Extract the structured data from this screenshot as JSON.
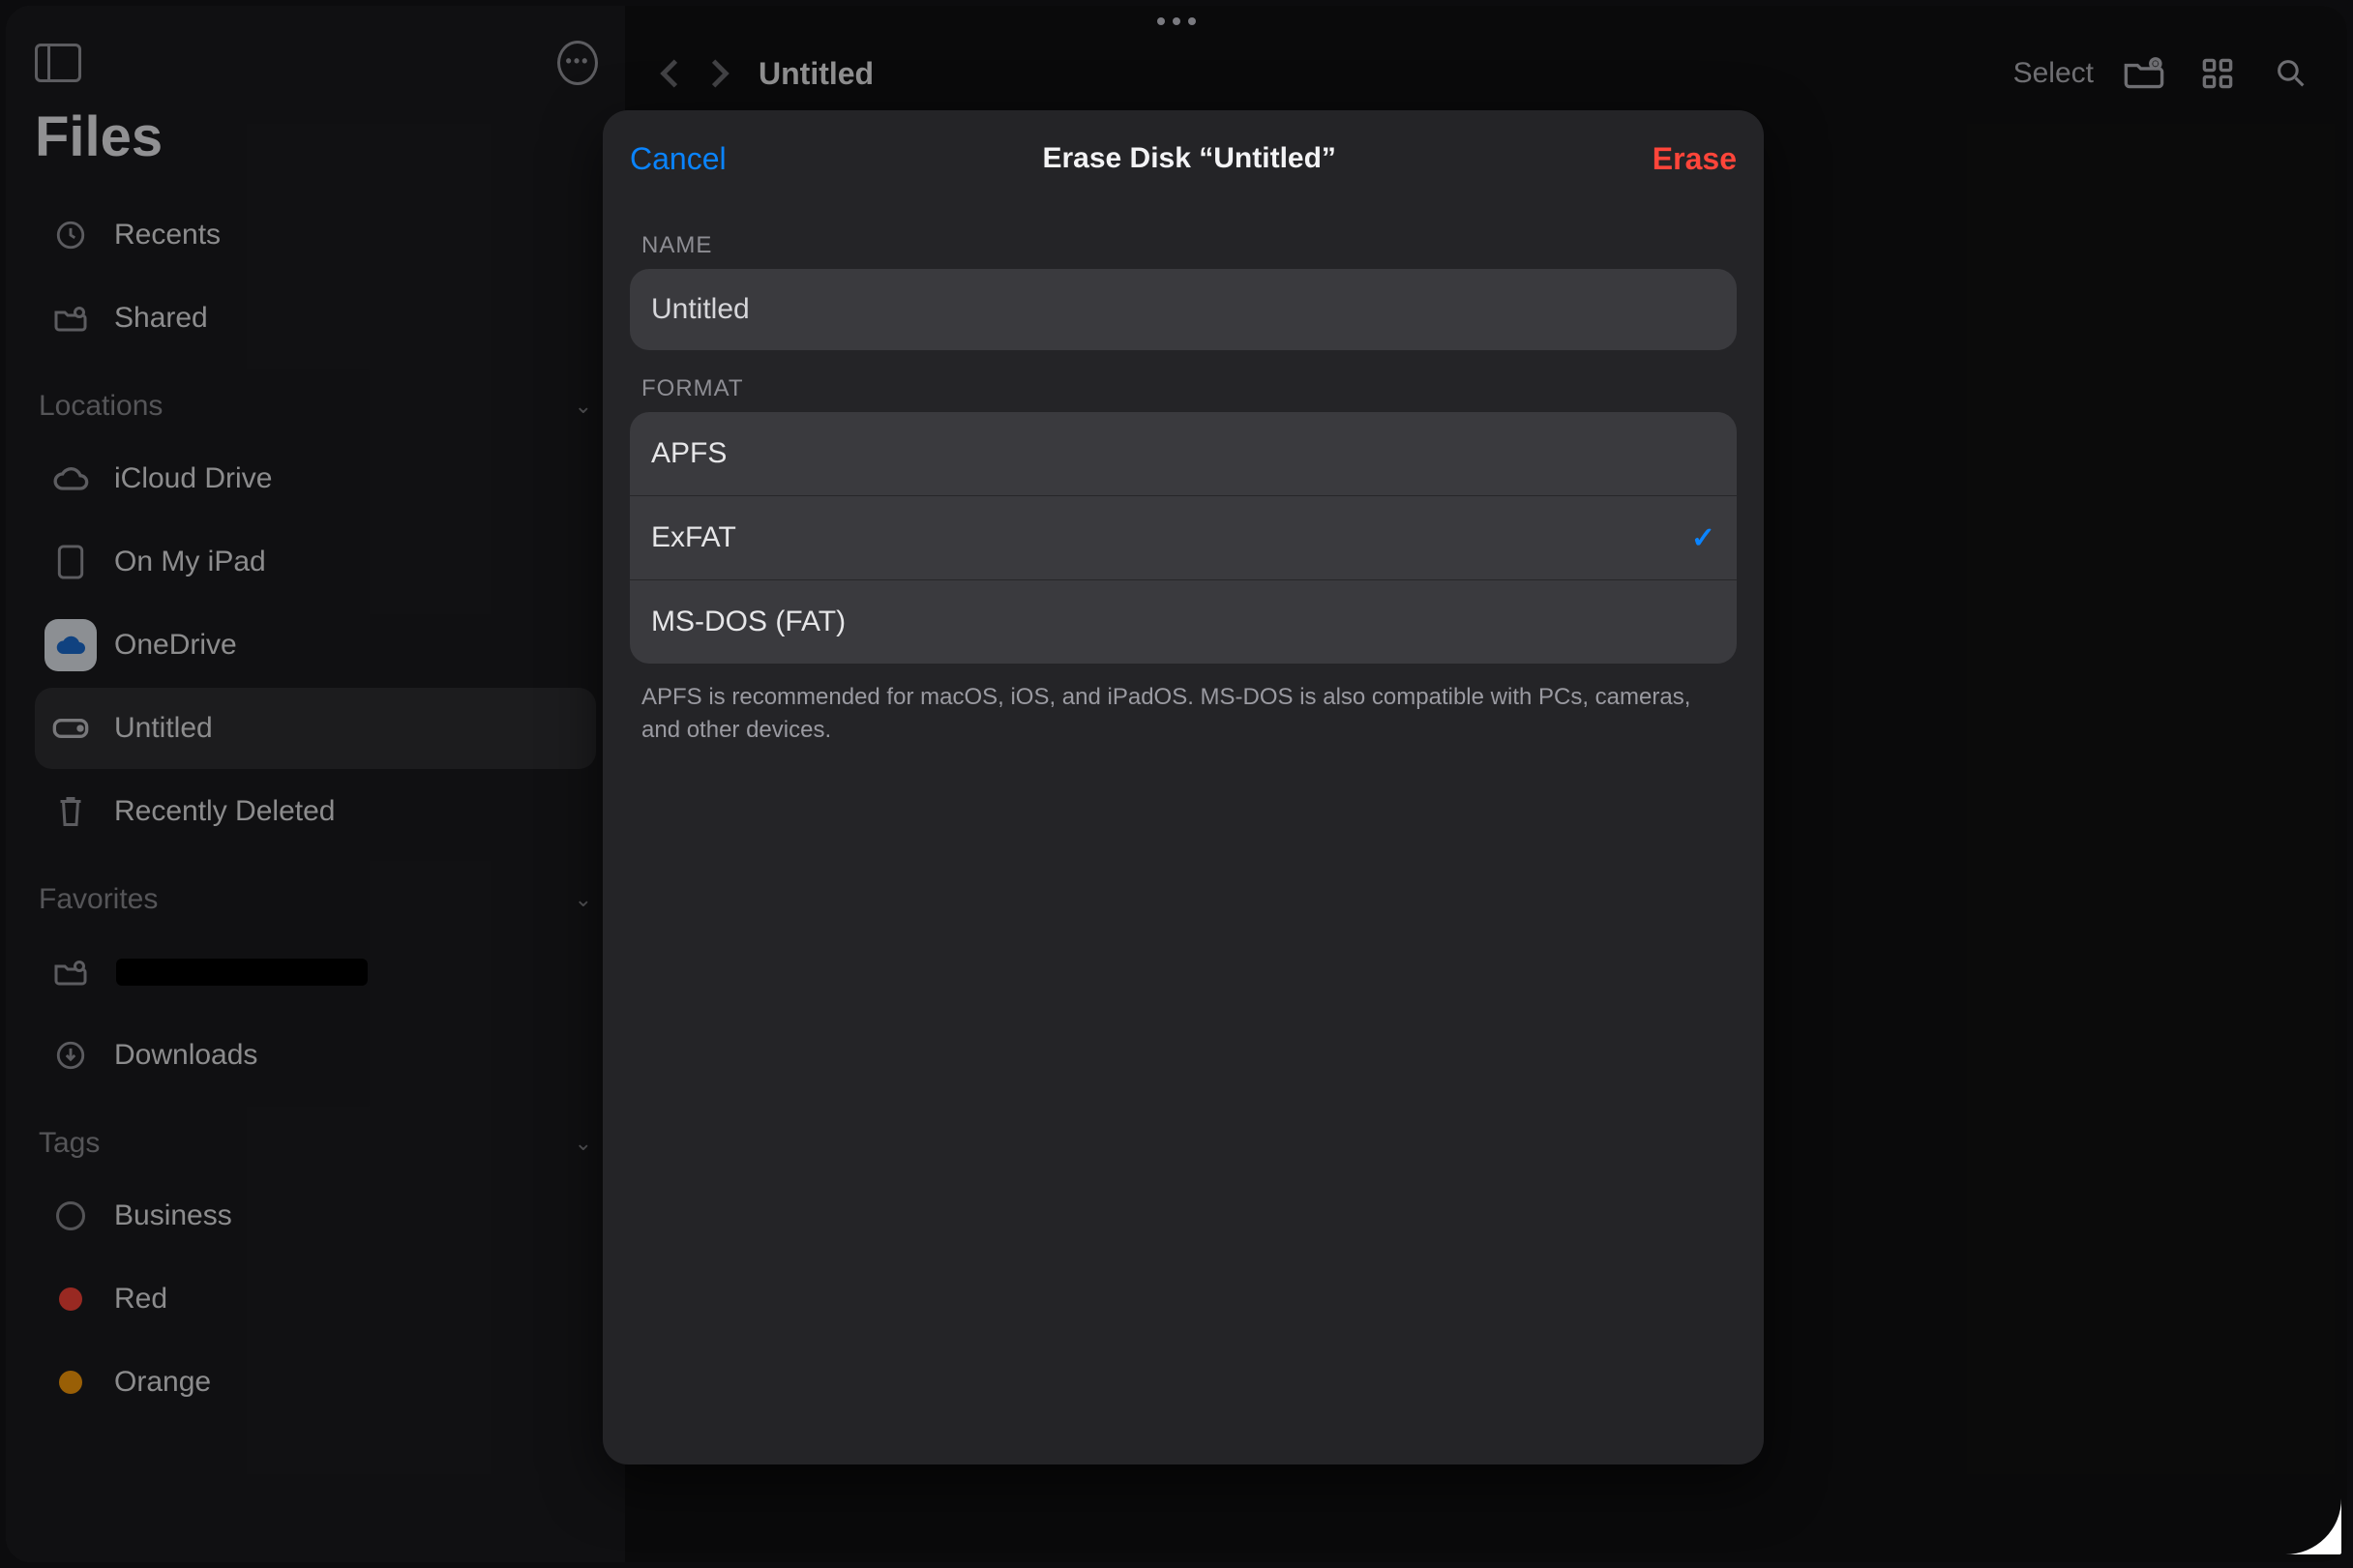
{
  "app": {
    "title": "Files"
  },
  "sidebar": {
    "top_items": [
      {
        "label": "Recents"
      },
      {
        "label": "Shared"
      }
    ],
    "sections": [
      {
        "title": "Locations",
        "items": [
          {
            "label": "iCloud Drive",
            "icon": "cloud"
          },
          {
            "label": "On My iPad",
            "icon": "ipad"
          },
          {
            "label": "OneDrive",
            "icon": "onedrive"
          },
          {
            "label": "Untitled",
            "icon": "drive",
            "selected": true
          },
          {
            "label": "Recently Deleted",
            "icon": "trash"
          }
        ]
      },
      {
        "title": "Favorites",
        "items": [
          {
            "label": "",
            "icon": "folder-person",
            "redacted": true
          },
          {
            "label": "Downloads",
            "icon": "download"
          }
        ]
      },
      {
        "title": "Tags",
        "items": [
          {
            "label": "Business",
            "tag": "outline"
          },
          {
            "label": "Red",
            "tag": "red"
          },
          {
            "label": "Orange",
            "tag": "orange"
          }
        ]
      }
    ]
  },
  "toolbar": {
    "title": "Untitled",
    "select": "Select"
  },
  "sheet": {
    "cancel": "Cancel",
    "title": "Erase Disk “Untitled”",
    "erase": "Erase",
    "name_label": "NAME",
    "name_value": "Untitled",
    "format_label": "FORMAT",
    "formats": [
      {
        "label": "APFS",
        "selected": false
      },
      {
        "label": "ExFAT",
        "selected": true
      },
      {
        "label": "MS-DOS (FAT)",
        "selected": false
      }
    ],
    "hint": "APFS is recommended for macOS, iOS, and iPadOS. MS-DOS is also compatible with PCs, cameras, and other devices."
  },
  "colors": {
    "blue": "#0a84ff",
    "red": "#ff453a",
    "orange": "#ff9f0a"
  }
}
